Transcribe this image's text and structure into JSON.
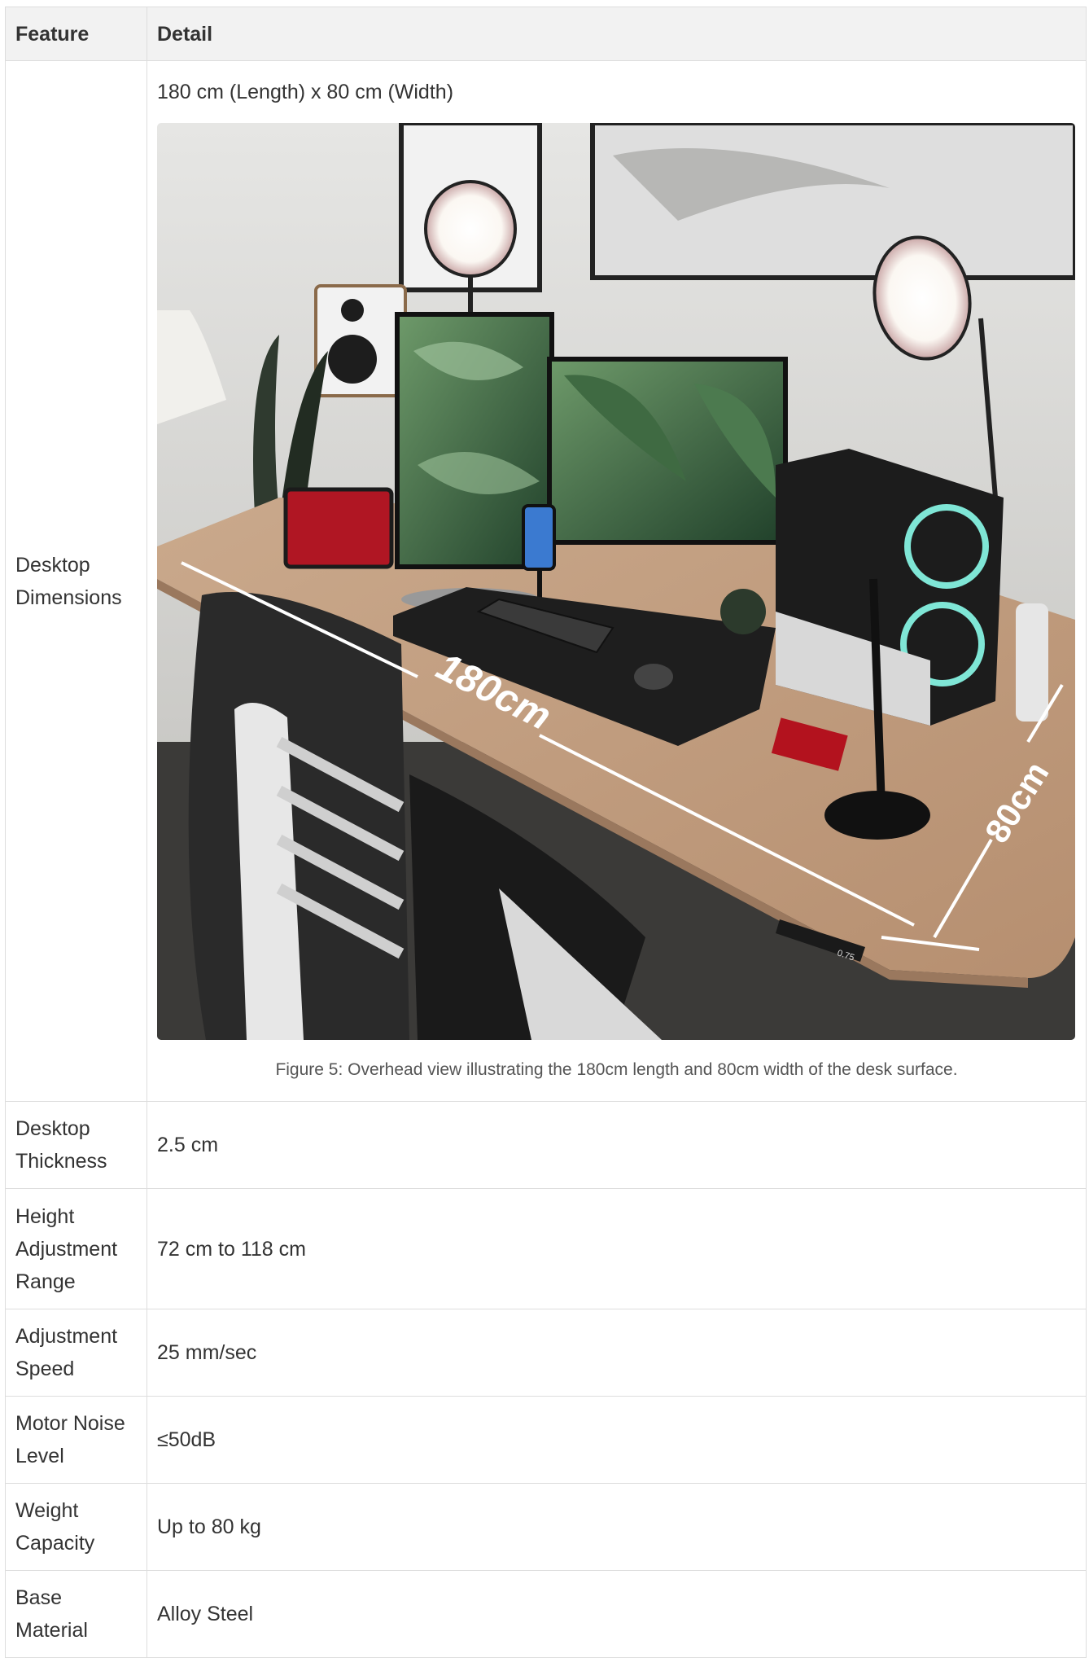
{
  "header": {
    "feature": "Feature",
    "detail": "Detail"
  },
  "rows": [
    {
      "feature": "Desktop Dimensions",
      "detail": "180 cm (Length) x 80 cm (Width)"
    },
    {
      "feature": "Desktop Thickness",
      "detail": "2.5 cm"
    },
    {
      "feature": "Height Adjustment Range",
      "detail": "72 cm to 118 cm"
    },
    {
      "feature": "Adjustment Speed",
      "detail": "25 mm/sec"
    },
    {
      "feature": "Motor Noise Level",
      "detail": "≤50dB"
    },
    {
      "feature": "Weight Capacity",
      "detail": "Up to 80 kg"
    },
    {
      "feature": "Base Material",
      "detail": "Alloy Steel"
    }
  ],
  "figure": {
    "caption": "Figure 5: Overhead view illustrating the 180cm length and 80cm width of the desk surface.",
    "length_label": "180cm",
    "width_label": "80cm",
    "panel_time": "0.75"
  }
}
